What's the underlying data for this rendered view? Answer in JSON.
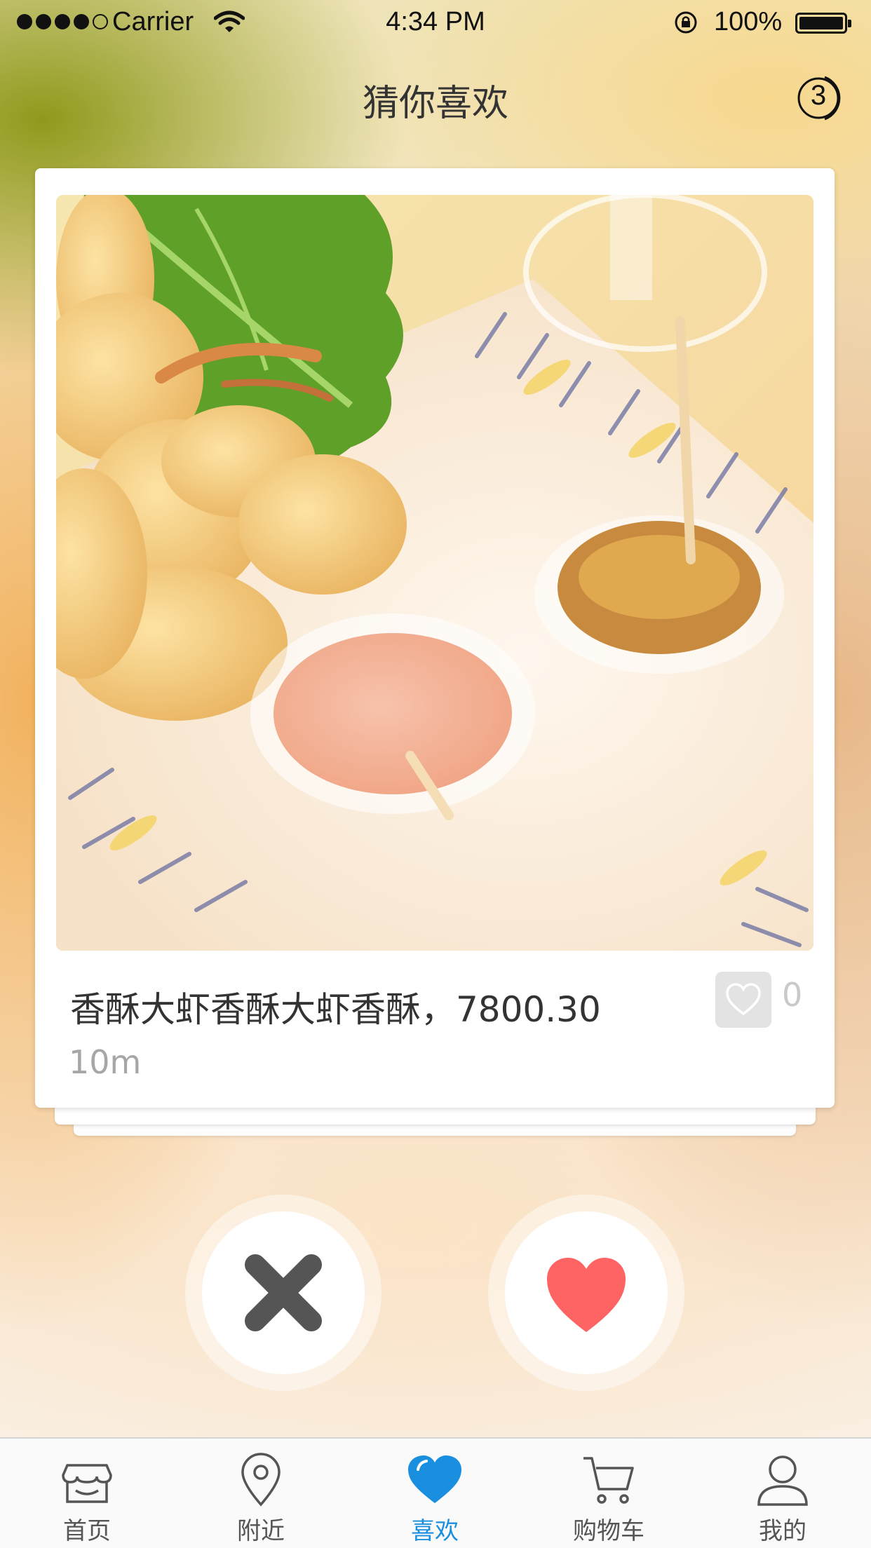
{
  "status_bar": {
    "carrier": "Carrier",
    "time": "4:34 PM",
    "battery_percent": "100%",
    "signal_strength": 4,
    "signal_max": 5
  },
  "nav": {
    "title": "猜你喜欢",
    "counter": "3"
  },
  "card": {
    "title": "香酥大虾香酥大虾香酥，7800.30",
    "distance": "10m",
    "like_count": "0",
    "image_icon": "fried-shrimp-photo"
  },
  "actions": {
    "dislike_icon": "close-icon",
    "like_icon": "heart-icon",
    "like_color": "#ff6464",
    "dislike_color": "#555555"
  },
  "tabs": [
    {
      "label": "首页",
      "icon": "store-icon",
      "active": false
    },
    {
      "label": "附近",
      "icon": "location-pin-icon",
      "active": false
    },
    {
      "label": "喜欢",
      "icon": "heart-icon",
      "active": true
    },
    {
      "label": "购物车",
      "icon": "cart-icon",
      "active": false
    },
    {
      "label": "我的",
      "icon": "user-icon",
      "active": false
    }
  ],
  "colors": {
    "accent": "#1a8fe0",
    "tab_inactive": "#555555"
  }
}
